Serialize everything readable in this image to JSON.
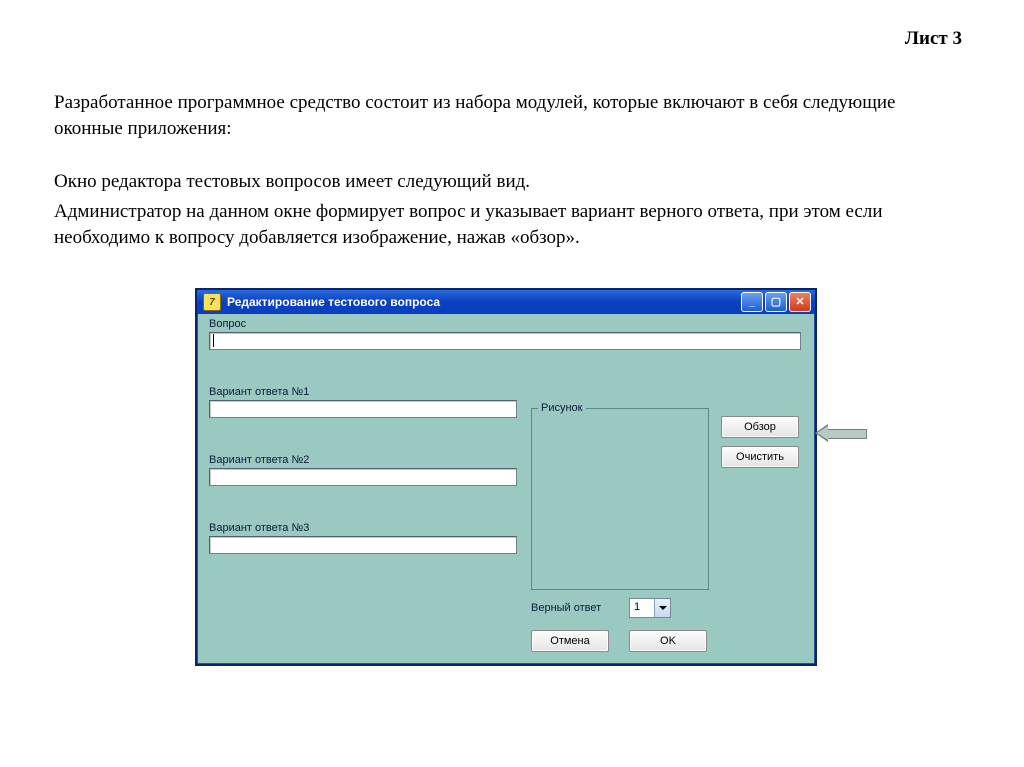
{
  "page": {
    "header": "Лист 3",
    "para1": "Разработанное программное средство состоит из набора модулей, которые включают в себя следующие оконные приложения:",
    "para2a": "Окно редактора тестовых вопросов имеет следующий вид.",
    "para2b": "Администратор на данном окне формирует вопрос  и указывает вариант верного ответа, при этом если необходимо к вопросу добавляется изображение, нажав «обзор»."
  },
  "window": {
    "title": "Редактирование тестового вопроса",
    "app_icon_text": "7",
    "labels": {
      "question": "Вопрос",
      "answer1": "Вариант ответа №1",
      "answer2": "Вариант ответа №2",
      "answer3": "Вариант ответа №3",
      "picture_group": "Рисунок",
      "correct_answer": "Верный ответ"
    },
    "inputs": {
      "question": "",
      "answer1": "",
      "answer2": "",
      "answer3": ""
    },
    "buttons": {
      "browse": "Обзор",
      "clear": "Очистить",
      "cancel": "Отмена",
      "ok": "OK"
    },
    "correct_answer_value": "1"
  }
}
